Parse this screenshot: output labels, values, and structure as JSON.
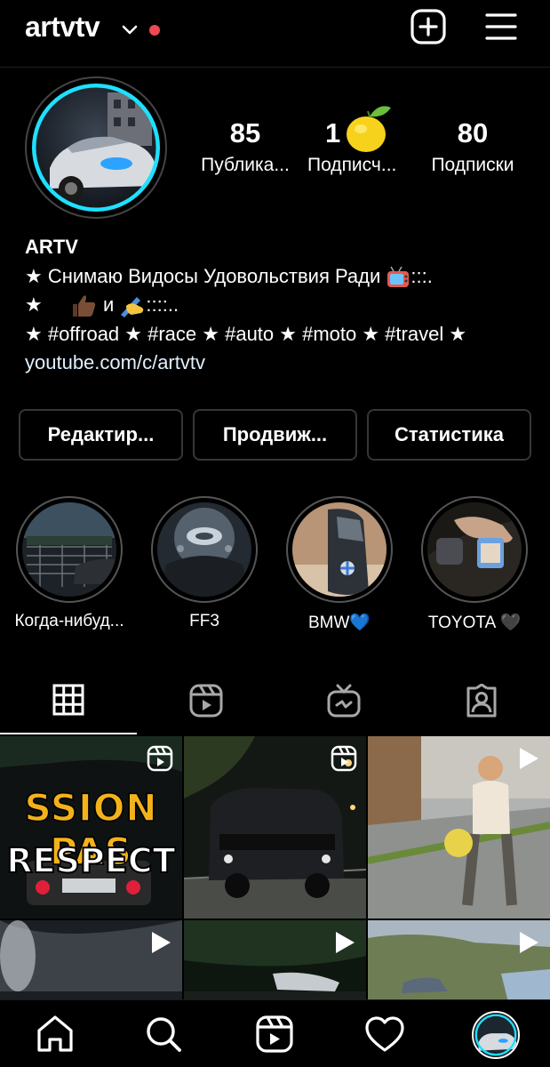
{
  "header": {
    "username": "artvtv",
    "icons": [
      "chevron-down-icon",
      "new-post-icon",
      "menu-icon"
    ],
    "notification_color": "#ed4956"
  },
  "profile": {
    "stats": [
      {
        "value": "85",
        "label": "Публика..."
      },
      {
        "value": "1",
        "label": "Подписч..."
      },
      {
        "value": "80",
        "label": "Подписки"
      }
    ],
    "name": "ARTV",
    "bio": {
      "line1": "★ Снимаю Видосы Удовольствия Ради",
      "line1_tail": ":::.",
      "line2_a": "★",
      "line2_b": "и",
      "line2_tail": "::::..",
      "line3": "★ #offroad ★ #race ★ #auto ★ #moto ★ #travel ★",
      "link": "youtube.com/c/artvtv"
    }
  },
  "buttons": {
    "edit": "Редактир...",
    "promote": "Продвиж...",
    "stats": "Статистика"
  },
  "highlights": [
    {
      "label": "Когда-нибуд..."
    },
    {
      "label": "FF3"
    },
    {
      "label": "BMW💙"
    },
    {
      "label": "TOYOTA 🖤"
    }
  ],
  "tabs": [
    "grid-icon",
    "reels-icon",
    "igtv-icon",
    "tagged-icon"
  ],
  "posts": [
    {
      "overlay_line1": "SSION PAS",
      "overlay_line2": "RESPECT",
      "icon": "reels-icon"
    },
    {
      "icon": "reels-icon"
    },
    {
      "icon": "play-icon"
    },
    {
      "icon": "play-icon"
    },
    {
      "icon": "play-icon"
    },
    {
      "icon": "play-icon"
    }
  ],
  "bottom_nav": [
    "home-icon",
    "search-icon",
    "reels-icon",
    "heart-icon",
    "profile-avatar"
  ]
}
